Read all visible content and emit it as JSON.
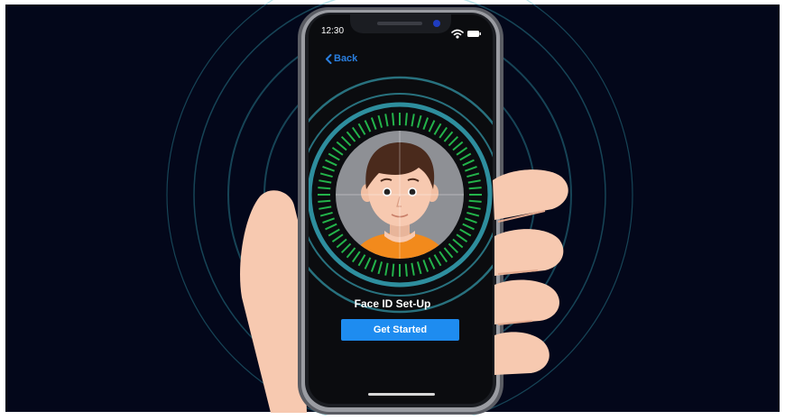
{
  "status_bar": {
    "time": "12:30"
  },
  "nav": {
    "back_label": "Back"
  },
  "faceid": {
    "title": "Face ID Set-Up",
    "button_label": "Get Started"
  },
  "colors": {
    "background": "#03071a",
    "scan_rings": "#3cb6c8",
    "tick_marks": "#23b34a",
    "button": "#1e8cf0",
    "skin": "#f7c9b0",
    "shirt": "#f28a1c",
    "hair": "#4a2a1c"
  },
  "icons": [
    "chevron-left-icon",
    "wifi-icon",
    "battery-icon",
    "front-camera-icon"
  ]
}
